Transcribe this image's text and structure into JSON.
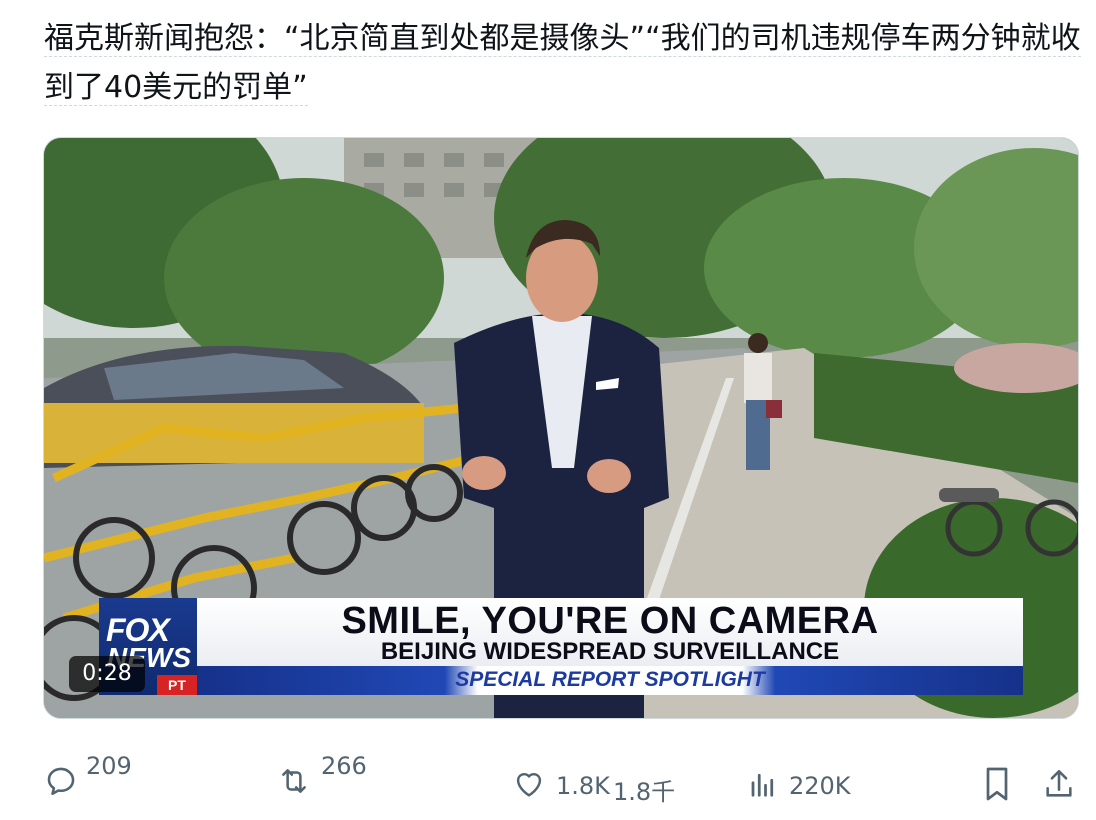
{
  "tweet": {
    "text_line1": "福克斯新闻抱怨：“北京简直到处都是摄像头”“我们的司机违规停车两分钟就收",
    "text_line2": "到了40美元的罚单”"
  },
  "video": {
    "duration": "0:28",
    "chyron": {
      "headline": "SMILE, YOU'RE ON CAMERA",
      "subline": "BEIJING WIDESPREAD SURVEILLANCE",
      "segment": "SPECIAL REPORT SPOTLIGHT"
    },
    "logo": {
      "top": "FOX",
      "bottom": "NEWS",
      "badge": "PT"
    }
  },
  "actions": {
    "reply_count": "209",
    "retweet_count": "266",
    "like_count": "1.8K",
    "like_count_cn": "1.8千",
    "view_count": "220K"
  },
  "colors": {
    "icon_gray": "#536471",
    "text": "#0f1419",
    "fox_blue": "#1a3a8f",
    "fox_red": "#d62424"
  }
}
